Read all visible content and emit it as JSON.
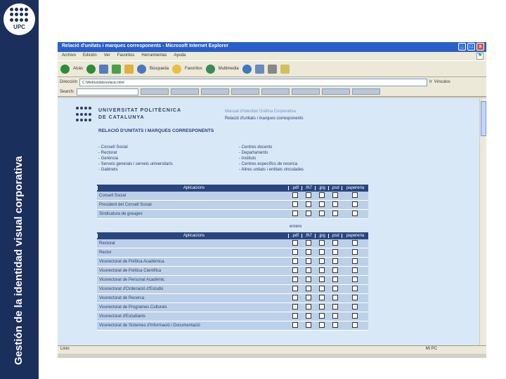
{
  "slide": {
    "vertical_title": "Gestión de la identidad visual corporativa",
    "logo_text": "UPC"
  },
  "browser": {
    "title": "Relació d'unitats i marques corresponents - Microsoft Internet Explorer",
    "menu": [
      "Archivo",
      "Edición",
      "Ver",
      "Favoritos",
      "Herramientas",
      "Ayuda"
    ],
    "toolbar": {
      "back": "Atrás",
      "search": "Búsqueda",
      "favorites": "Favoritos",
      "multimedia": "Multimedia"
    },
    "address_label": "Dirección",
    "address_value": "C:\\Web\\unitats\\relacio.html",
    "go_label": "Ir",
    "links_label": "Vínculos",
    "search_label": "Search:",
    "status_left": "Listo",
    "status_zone": "Mi PC"
  },
  "page": {
    "univ_line1": "UNIVERSITAT POLITÈCNICA",
    "univ_line2": "DE CATALUNYA",
    "manual": "Manual d'Identitat Gràfica Corporativa",
    "subtitle": "Relació d'unitats i marques corresponents",
    "heading": "RELACIÓ D'UNITATS I MARQUES CORRESPONENTS",
    "list_left": [
      "- Consell Social",
      "- Rectorat",
      "- Gerència",
      "- Serveis generals i serveis universitaris",
      "- Gabinets"
    ],
    "list_right": [
      "- Centres docents",
      "- Departaments",
      "- Instituts",
      "- Centres específics de recerca",
      "- Altres unitats i entitats vinculades"
    ],
    "table_headers": [
      "Aplicacions",
      ".pdf",
      ".fh7",
      ".jpg",
      ".psd",
      "papereria"
    ],
    "table1_rows": [
      "Consell Social",
      "President del Consell Social",
      "Sindicatura de greuges"
    ],
    "mid_label": "enrere",
    "table2_rows": [
      "Rectorat",
      "Rector",
      "Vicerectorat de Política Acadèmica",
      "Vicerectorat de Política Científica",
      "Vicerectorat de Personal Acadèmic",
      "Vicerectorat d'Ordenació d'Estudis",
      "Vicerectorat de Recerca",
      "Vicerectorat de Programes Culturals",
      "Vicerectorat d'Estudiants",
      "Vicerectorat de Sistemes d'Informació i Documentació"
    ]
  }
}
